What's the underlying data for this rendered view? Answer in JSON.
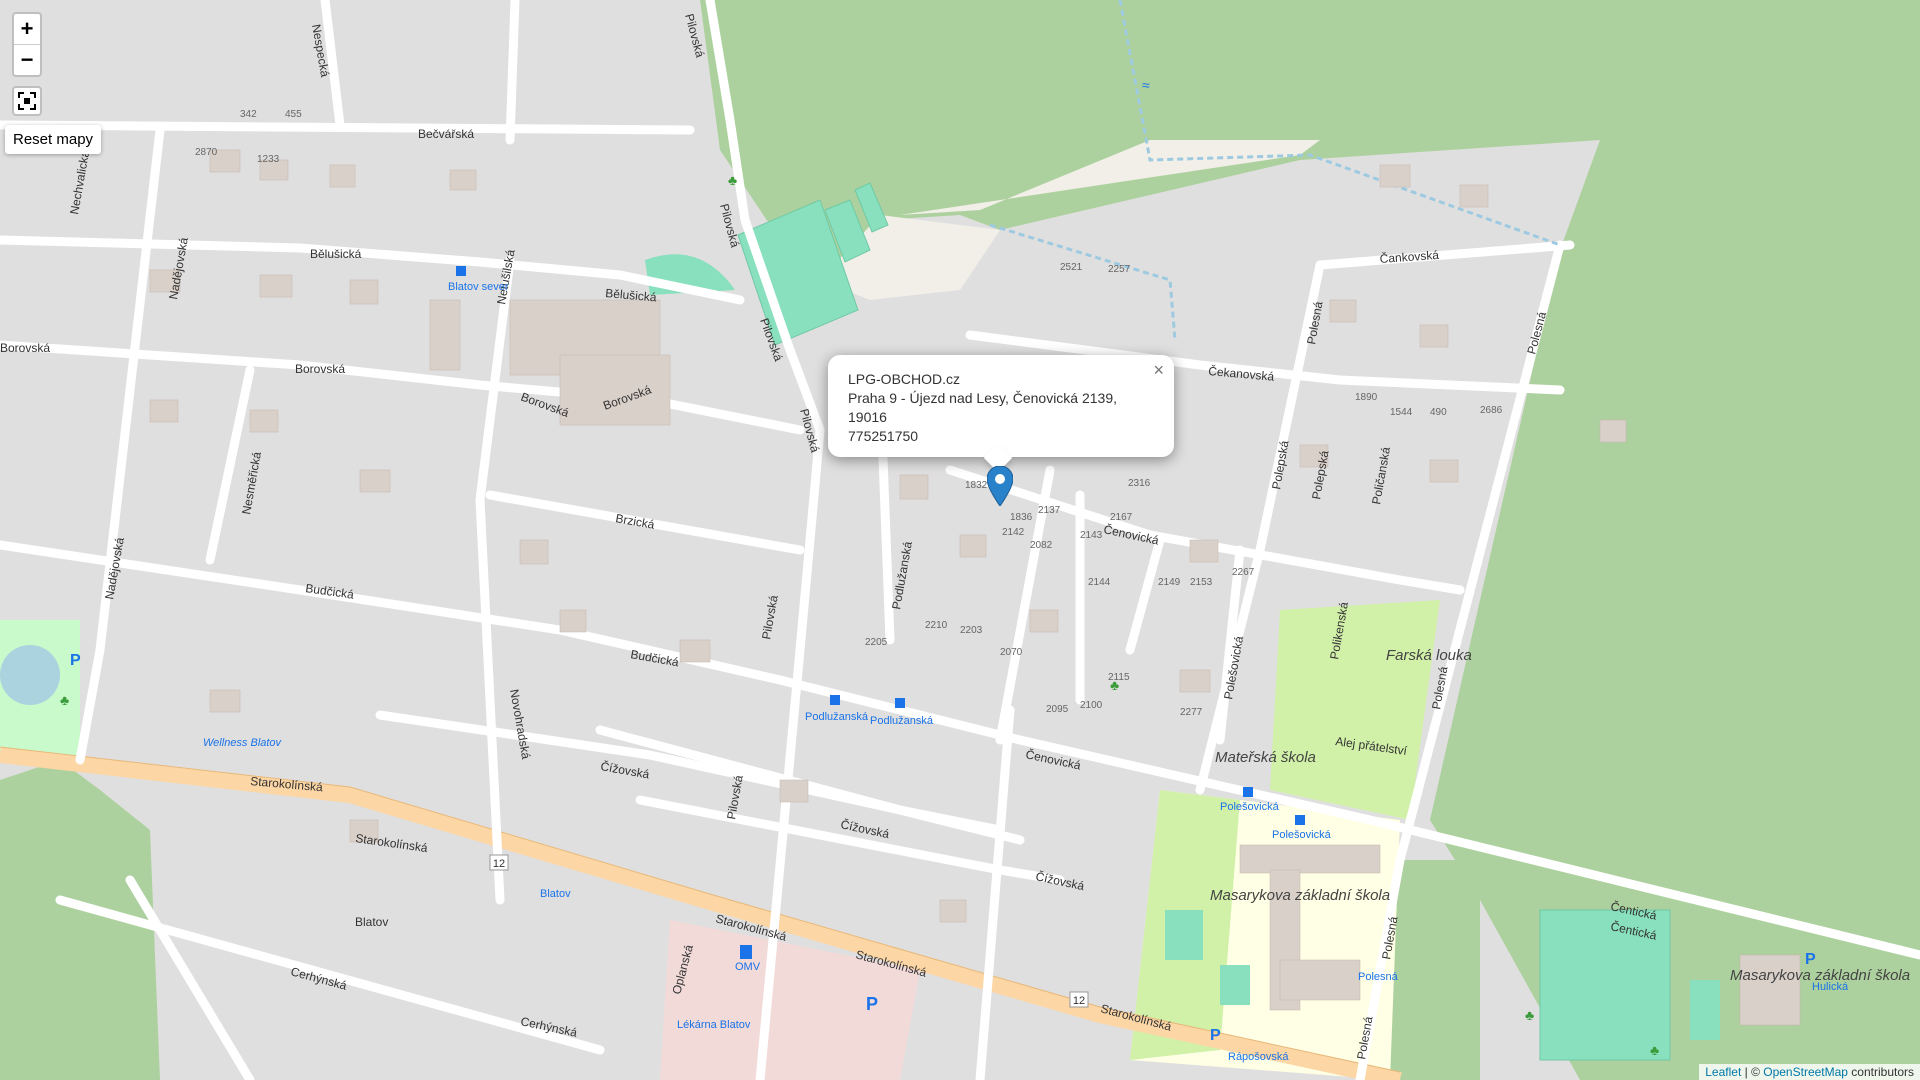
{
  "map": {
    "controls": {
      "zoom_in": "+",
      "zoom_out": "−",
      "reset_label": "Reset mapy"
    },
    "popup": {
      "title": "LPG-OBCHOD.cz",
      "address_line1": "Praha 9 - Újezd nad Lesy, Čenovická 2139,",
      "address_line2": "19016",
      "phone": "775251750",
      "close": "×"
    },
    "attribution": {
      "leaflet": "Leaflet",
      "separator": " | © ",
      "osm": "OpenStreetMap",
      "suffix": " contributors"
    },
    "streets": [
      "Bečvářská",
      "Bělušická",
      "Bělušická",
      "Borovská",
      "Borovská",
      "Borovská",
      "Borovská",
      "Brzická",
      "Budčická",
      "Budčická",
      "Starokolínská",
      "Starokolínská",
      "Starokolínská",
      "Starokolínská",
      "Starokolínská",
      "Čížovská",
      "Čížovská",
      "Čížovská",
      "Čenovická",
      "Čenovická",
      "Čentická",
      "Čentická",
      "Čankovská",
      "Čekanovská",
      "Pilovská",
      "Pilovská",
      "Pilovská",
      "Pilovská",
      "Pilovská",
      "Pilovská",
      "Polesná",
      "Polesná",
      "Polesná",
      "Polesná",
      "Polesná",
      "Polepská",
      "Polepská",
      "Poličanská",
      "Podlužanská",
      "Polikenská",
      "Polešovická",
      "Nadějovská",
      "Nadějovská",
      "Nechvalická",
      "Nespecká",
      "Netušilská",
      "Nesměřická",
      "Novohradská",
      "Cerhýnská",
      "Cerhýnská",
      "Oplanská",
      "Alej přátelství"
    ],
    "pois": [
      "Blatov sever",
      "Podlužanská",
      "Podlužanská",
      "Polešovická",
      "Polešovická",
      "Blatov",
      "Polesná",
      "Rápošovská",
      "Hulická",
      "OMV",
      "Lékárna Blatov",
      "Wellness Blatov"
    ],
    "areas": [
      "Masarykova základní škola",
      "Farská louka",
      "Mateřská škola",
      "Blatov",
      "Masarykova základní škola"
    ],
    "route_number": "12",
    "colors": {
      "background": "#e0dfdf",
      "forest": "#add19e",
      "pitch": "#88e0be",
      "main_road": "#fcd6a4",
      "school": "#ffffe5",
      "marker": "#2981ca",
      "parking": "#eeeeee"
    }
  }
}
